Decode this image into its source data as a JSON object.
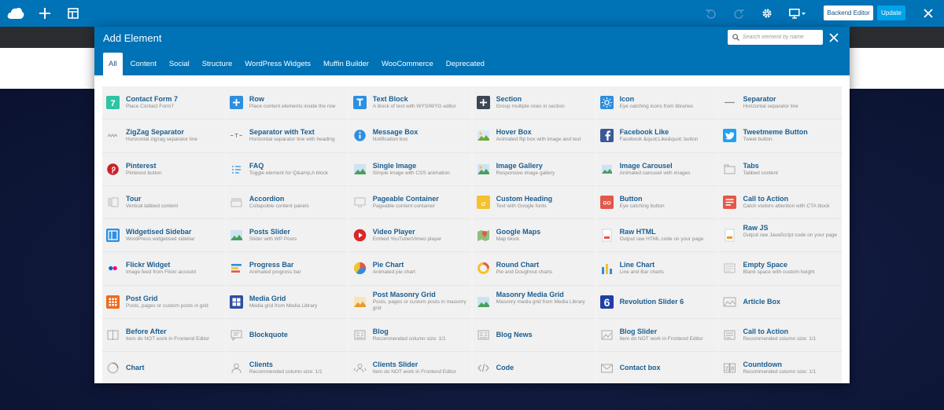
{
  "toolbar": {
    "backend_label": "Backend Editor",
    "update_label": "Update"
  },
  "modal": {
    "title": "Add Element",
    "search_placeholder": "Search element by name",
    "tabs": [
      "All",
      "Content",
      "Social",
      "Structure",
      "WordPress Widgets",
      "Muffin Builder",
      "WooCommerce",
      "Deprecated"
    ],
    "active_tab": "All"
  },
  "elements": [
    {
      "name": "Contact Form 7",
      "desc": "Place Contact Form7",
      "icon": "contact-form-7-icon",
      "color": "#2ec4a4"
    },
    {
      "name": "Row",
      "desc": "Place content elements inside the row",
      "icon": "row-plus-icon",
      "color": "#2d8fe0"
    },
    {
      "name": "Text Block",
      "desc": "A block of text with WYSIWYG editor",
      "icon": "text-block-t-icon",
      "color": "#2d8fe0"
    },
    {
      "name": "Section",
      "desc": "Group multiple rows in section",
      "icon": "section-plus-icon",
      "color": "#3d4653"
    },
    {
      "name": "Icon",
      "desc": "Eye catching icons from libraries",
      "icon": "sun-icon",
      "color": "#2d8fe0"
    },
    {
      "name": "Separator",
      "desc": "Horizontal separator line",
      "icon": "separator-line-icon",
      "color": "#c8c8c8"
    },
    {
      "name": "ZigZag Separator",
      "desc": "Horizontal zigzag separator line",
      "icon": "zigzag-icon",
      "color": "#c8c8c8"
    },
    {
      "name": "Separator with Text",
      "desc": "Horizontal separator line with heading",
      "icon": "separator-text-icon",
      "color": "#c8c8c8"
    },
    {
      "name": "Message Box",
      "desc": "Notification box",
      "icon": "info-icon",
      "color": "#2d8fe0"
    },
    {
      "name": "Hover Box",
      "desc": "Animated flip box with image and text",
      "icon": "hover-box-image-icon",
      "color": "#6fa83a"
    },
    {
      "name": "Facebook Like",
      "desc": "Facebook &quot;Like&quot; button",
      "icon": "facebook-icon",
      "color": "#3b5998"
    },
    {
      "name": "Tweetmeme Button",
      "desc": "Tweet button",
      "icon": "twitter-icon",
      "color": "#1da1f2"
    },
    {
      "name": "Pinterest",
      "desc": "Pinterest button",
      "icon": "pinterest-icon",
      "color": "#cb2027"
    },
    {
      "name": "FAQ",
      "desc": "Toggle element for Q&amp;A block",
      "icon": "faq-toggle-icon",
      "color": "#2d8fe0"
    },
    {
      "name": "Single Image",
      "desc": "Simple image with CSS animation",
      "icon": "single-image-icon",
      "color": "#4a9e5c"
    },
    {
      "name": "Image Gallery",
      "desc": "Responsive image gallery",
      "icon": "image-gallery-icon",
      "color": "#4a9e5c"
    },
    {
      "name": "Image Carousel",
      "desc": "Animated carousel with images",
      "icon": "image-carousel-icon",
      "color": "#4a9e5c"
    },
    {
      "name": "Tabs",
      "desc": "Tabbed content",
      "icon": "tabs-icon",
      "color": "#c8c8c8"
    },
    {
      "name": "Tour",
      "desc": "Vertical tabbed content",
      "icon": "tour-icon",
      "color": "#c8c8c8"
    },
    {
      "name": "Accordion",
      "desc": "Collapsible content panels",
      "icon": "accordion-icon",
      "color": "#c8c8c8"
    },
    {
      "name": "Pageable Container",
      "desc": "Pageable content container",
      "icon": "pageable-container-icon",
      "color": "#c8c8c8"
    },
    {
      "name": "Custom Heading",
      "desc": "Text with Google fonts",
      "icon": "custom-heading-a-icon",
      "color": "#f5c12e"
    },
    {
      "name": "Button",
      "desc": "Eye catching button",
      "icon": "button-go-icon",
      "color": "#e5574a"
    },
    {
      "name": "Call to Action",
      "desc": "Catch visitors attention with CTA block",
      "icon": "call-to-action-icon",
      "color": "#e5574a"
    },
    {
      "name": "Widgetised Sidebar",
      "desc": "WordPress widgetised sidebar",
      "icon": "sidebar-icon",
      "color": "#2d8fe0"
    },
    {
      "name": "Posts Slider",
      "desc": "Slider with WP Posts",
      "icon": "posts-slider-icon",
      "color": "#4a9e5c"
    },
    {
      "name": "Video Player",
      "desc": "Embed YouTube/Vimeo player",
      "icon": "play-icon",
      "color": "#d62828"
    },
    {
      "name": "Google Maps",
      "desc": "Map block",
      "icon": "map-pin-icon",
      "color": "#34a853"
    },
    {
      "name": "Raw HTML",
      "desc": "Output raw HTML code on your page",
      "icon": "raw-html-icon",
      "color": "#e5574a"
    },
    {
      "name": "Raw JS",
      "desc": "Output raw JavaScript code on your page",
      "icon": "raw-js-icon",
      "color": "#e89a2a"
    },
    {
      "name": "Flickr Widget",
      "desc": "Image feed from Flickr account",
      "icon": "flickr-icon",
      "color": "#ff0084"
    },
    {
      "name": "Progress Bar",
      "desc": "Animated progress bar",
      "icon": "progress-bar-icon",
      "color": "#2d8fe0"
    },
    {
      "name": "Pie Chart",
      "desc": "Animated pie chart",
      "icon": "pie-chart-icon",
      "color": "#f5c12e"
    },
    {
      "name": "Round Chart",
      "desc": "Pie and Doughnut charts",
      "icon": "round-chart-icon",
      "color": "#f47b5a"
    },
    {
      "name": "Line Chart",
      "desc": "Line and Bar charts",
      "icon": "line-chart-icon",
      "color": "#2d8fe0"
    },
    {
      "name": "Empty Space",
      "desc": "Blank space with custom height",
      "icon": "empty-space-icon",
      "color": "#c8c8c8"
    },
    {
      "name": "Post Grid",
      "desc": "Posts, pages or custom posts in grid",
      "icon": "post-grid-icon",
      "color": "#f06a20"
    },
    {
      "name": "Media Grid",
      "desc": "Media grid from Media Library",
      "icon": "media-grid-icon",
      "color": "#2d4fa0"
    },
    {
      "name": "Post Masonry Grid",
      "desc": "Posts, pages or custom posts in masonry grid",
      "icon": "post-masonry-grid-icon",
      "color": "#e89a2a"
    },
    {
      "name": "Masonry Media Grid",
      "desc": "Masonry media grid from Media Library",
      "icon": "masonry-media-grid-icon",
      "color": "#4a9e5c"
    },
    {
      "name": "Revolution Slider 6",
      "desc": "",
      "icon": "revolution-slider-6-icon",
      "color": "#1f3fa8"
    },
    {
      "name": "Article Box",
      "desc": "",
      "icon": "article-box-icon",
      "color": "#c8c8c8"
    },
    {
      "name": "Before After",
      "desc": "Item do NOT work in Frontend Editor",
      "icon": "before-after-icon",
      "color": "#c8c8c8"
    },
    {
      "name": "Blockquote",
      "desc": "",
      "icon": "blockquote-icon",
      "color": "#c8c8c8"
    },
    {
      "name": "Blog",
      "desc": "Recommended column size: 1/1",
      "icon": "blog-icon",
      "color": "#c8c8c8"
    },
    {
      "name": "Blog News",
      "desc": "",
      "icon": "blog-news-icon",
      "color": "#c8c8c8"
    },
    {
      "name": "Blog Slider",
      "desc": "Item do NOT work in Frontend Editor",
      "icon": "blog-slider-icon",
      "color": "#c8c8c8"
    },
    {
      "name": "Call to Action",
      "desc": "Recommended column size: 1/1",
      "icon": "call-to-action-outline-icon",
      "color": "#c8c8c8"
    },
    {
      "name": "Chart",
      "desc": "",
      "icon": "chart-ring-icon",
      "color": "#c8c8c8"
    },
    {
      "name": "Clients",
      "desc": "Recommended column size: 1/1",
      "icon": "clients-icon",
      "color": "#c8c8c8"
    },
    {
      "name": "Clients Slider",
      "desc": "Item do NOT work in Frontend Editor",
      "icon": "clients-slider-icon",
      "color": "#c8c8c8"
    },
    {
      "name": "Code",
      "desc": "",
      "icon": "code-icon",
      "color": "#c8c8c8"
    },
    {
      "name": "Contact box",
      "desc": "",
      "icon": "contact-box-envelope-icon",
      "color": "#c8c8c8"
    },
    {
      "name": "Countdown",
      "desc": "Recommended column size: 1/1",
      "icon": "countdown-icon",
      "color": "#c8c8c8"
    }
  ]
}
